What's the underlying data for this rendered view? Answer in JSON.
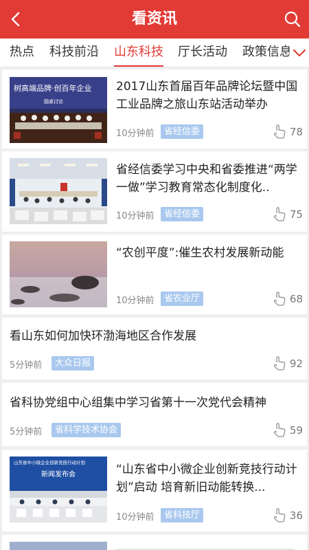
{
  "header": {
    "title": "看资讯"
  },
  "tabs": [
    "热点",
    "科技前沿",
    "山东科技",
    "厅长活动",
    "政策信息"
  ],
  "active_tab": "山东科技",
  "colors": {
    "brand": "#e23b36",
    "tag_bg": "#a9c8ee"
  },
  "articles": [
    {
      "title": "2017山东首届百年品牌论坛暨中国工业品牌之旅山东站活动举办",
      "time": "10分钟前",
      "source": "省经信委",
      "likes": "78",
      "thumb_text": [
        "树高端品牌·创百年企业",
        "圆桌讨论"
      ]
    },
    {
      "title": "省经信委学习中央和省委推进“两学一做”学习教育常态化制度化..",
      "time": "10分钟前",
      "source": "省经信委",
      "likes": "75"
    },
    {
      "title": "“农创平度”:催生农村发展新动能",
      "time": "10分钟前",
      "source": "省农业厅",
      "likes": "68"
    },
    {
      "title": "看山东如何加快环渤海地区合作发展",
      "time": "5分钟前",
      "source": "大众日报",
      "likes": "92"
    },
    {
      "title": "省科协党组中心组集中学习省第十一次党代会精神",
      "time": "5分钟前",
      "source": "省科学技术协会",
      "likes": "59"
    },
    {
      "title": "“山东省中小微企业创新竞技行动计划”启动 培育新旧动能转换...",
      "time": "10分钟前",
      "source": "省科技厅",
      "likes": "36",
      "thumb_text": [
        "山东省中小微企业创新竞技行动计划",
        "新闻发布会"
      ]
    }
  ]
}
